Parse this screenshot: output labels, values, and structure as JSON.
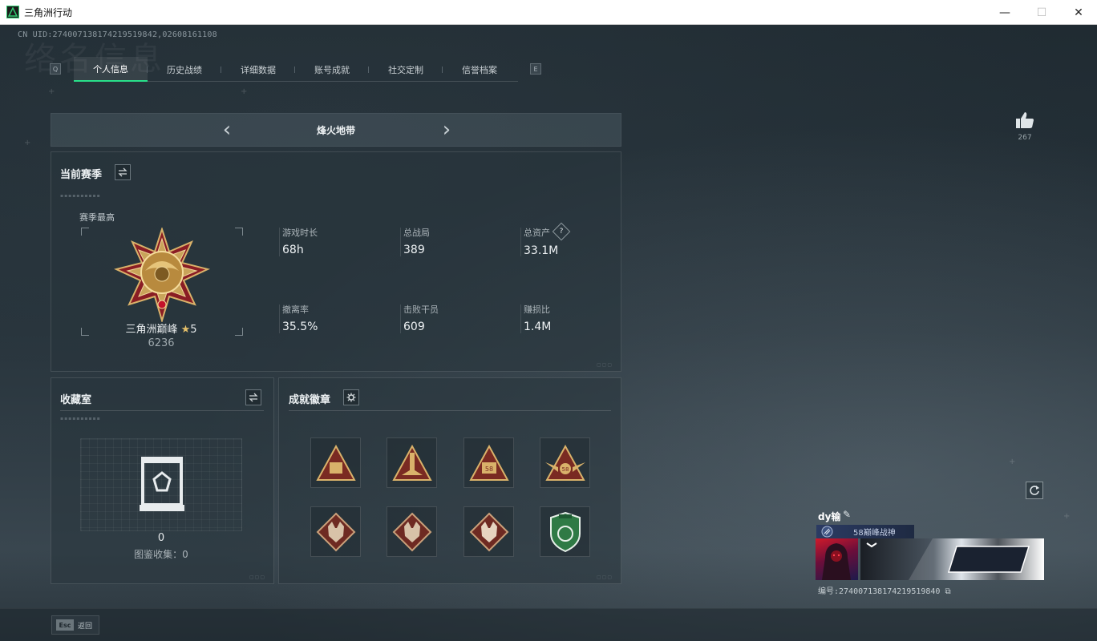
{
  "window": {
    "title": "三角洲行动",
    "minimize": "—",
    "maximize": "☐",
    "close": "✕"
  },
  "header": {
    "uid": "CN UID:274007138174219519842,02608161108",
    "watermark": "络名信息"
  },
  "tabs": {
    "left_key": "Q",
    "right_key": "E",
    "items": [
      {
        "label": "个人信息",
        "active": true
      },
      {
        "label": "历史战绩",
        "active": false
      },
      {
        "label": "详细数据",
        "active": false
      },
      {
        "label": "账号成就",
        "active": false
      },
      {
        "label": "社交定制",
        "active": false
      },
      {
        "label": "信誉档案",
        "active": false
      }
    ]
  },
  "mode_selector": {
    "prev": "‹",
    "next": "›",
    "label": "烽火地带"
  },
  "current_season": {
    "title": "当前赛季",
    "season_best_label": "赛季最高",
    "rank_name": "三角洲巅峰",
    "rank_stars": "5",
    "rank_score": "6236",
    "stats": [
      {
        "label": "游戏时长",
        "value": "68h"
      },
      {
        "label": "总战局",
        "value": "389"
      },
      {
        "label": "总资产",
        "value": "33.1M",
        "has_help": true
      },
      {
        "label": "撤离率",
        "value": "35.5%"
      },
      {
        "label": "击败干员",
        "value": "609"
      },
      {
        "label": "赚损比",
        "value": "1.4M"
      }
    ],
    "help_glyph": "?"
  },
  "collection": {
    "title": "收藏室",
    "count": "0",
    "sub_label": "图鉴收集：0"
  },
  "badges": {
    "title": "成就徽章",
    "items": [
      {
        "icon": "triangle-crate-badge-icon",
        "color": "#c9a45a"
      },
      {
        "icon": "triangle-missile-badge-icon",
        "color": "#c9a45a"
      },
      {
        "icon": "triangle-58-badge-icon",
        "color": "#c9a45a"
      },
      {
        "icon": "winged-58-badge-icon",
        "color": "#c9a45a"
      },
      {
        "icon": "wolf-head-badge-icon",
        "color": "#9b4a3c"
      },
      {
        "icon": "wolf-head-badge-icon-2",
        "color": "#9b4a3c"
      },
      {
        "icon": "wolf-head-badge-icon-3",
        "color": "#9b4a3c"
      },
      {
        "icon": "green-shield-badge-icon",
        "color": "#2f7a45"
      }
    ]
  },
  "social": {
    "like_count": "267"
  },
  "namecard": {
    "name": "dy输",
    "title": "58巅峰战神",
    "id_text": "编号:274007138174219519840"
  },
  "footer": {
    "esc_key": "Esc",
    "back_label": "返回"
  },
  "colors": {
    "accent": "#29e08a",
    "gold": "#c9a45a",
    "panel": "#28343c"
  }
}
